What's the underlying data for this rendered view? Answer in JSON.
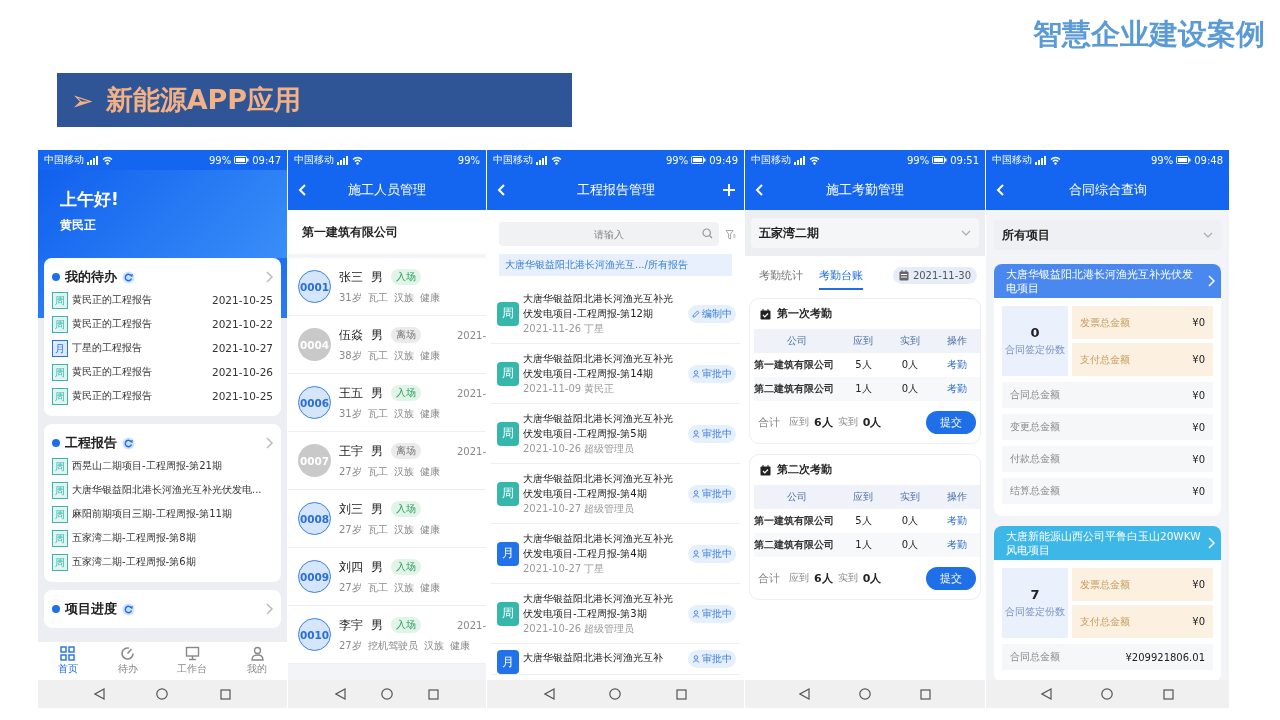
{
  "slide": {
    "brand": "智慧企业建设案例",
    "heading_marker": "➢",
    "heading": "新能源APP应用"
  },
  "phones": [
    {
      "kind": "home",
      "status": {
        "carrier": "中国移动",
        "battery": "99%",
        "time": "09:47"
      },
      "greeting": "上午好!",
      "user": "黄民正",
      "sections": [
        {
          "title": "我的待办",
          "items": [
            {
              "tag": "周",
              "color": "#35b8ab",
              "text": "黄民正的工程报告",
              "date": "2021-10-25"
            },
            {
              "tag": "周",
              "color": "#35b8ab",
              "text": "黄民正的工程报告",
              "date": "2021-10-22"
            },
            {
              "tag": "月",
              "color": "#2272ea",
              "text": "丁星的工程报告",
              "date": "2021-10-27"
            },
            {
              "tag": "周",
              "color": "#35b8ab",
              "text": "黄民正的工程报告",
              "date": "2021-10-26"
            },
            {
              "tag": "周",
              "color": "#35b8ab",
              "text": "黄民正的工程报告",
              "date": "2021-10-25"
            }
          ]
        },
        {
          "title": "工程报告",
          "items": [
            {
              "tag": "周",
              "color": "#35b8ab",
              "text": "西晃山二期项目-工程周报-第21期"
            },
            {
              "tag": "周",
              "color": "#35b8ab",
              "text": "大唐华银益阳北港长河渔光互补光伏发电..."
            },
            {
              "tag": "周",
              "color": "#35b8ab",
              "text": "麻阳前期项目三期-工程周报-第11期"
            },
            {
              "tag": "周",
              "color": "#35b8ab",
              "text": "五家湾二期-工程周报-第8期"
            },
            {
              "tag": "周",
              "color": "#35b8ab",
              "text": "五家湾二期-工程周报-第6期"
            }
          ]
        },
        {
          "title": "项目进度"
        }
      ],
      "tabbar": [
        {
          "label": "首页",
          "selected": true
        },
        {
          "label": "待办",
          "selected": false
        },
        {
          "label": "工作台",
          "selected": false
        },
        {
          "label": "我的",
          "selected": false
        }
      ]
    },
    {
      "kind": "staff",
      "status": {
        "carrier": "中国移动",
        "battery": "99%"
      },
      "title": "施工人员管理",
      "company": "第一建筑有限公司",
      "people": [
        {
          "id": "0001",
          "name": "张三",
          "gender": "男",
          "status": "入场",
          "present": true,
          "details": [
            "31岁",
            "瓦工",
            "汉族",
            "健康"
          ]
        },
        {
          "id": "0004",
          "name": "伍焱",
          "gender": "男",
          "status": "离场",
          "present": false,
          "details": [
            "38岁",
            "瓦工",
            "汉族",
            "健康"
          ],
          "date": "2021-"
        },
        {
          "id": "0006",
          "name": "王五",
          "gender": "男",
          "status": "入场",
          "present": true,
          "details": [
            "31岁",
            "瓦工",
            "汉族",
            "健康"
          ],
          "date": "2021-"
        },
        {
          "id": "0007",
          "name": "王宇",
          "gender": "男",
          "status": "离场",
          "present": false,
          "details": [
            "27岁",
            "瓦工",
            "汉族",
            "健康"
          ],
          "date": "2021-"
        },
        {
          "id": "0008",
          "name": "刘三",
          "gender": "男",
          "status": "入场",
          "present": true,
          "details": [
            "27岁",
            "瓦工",
            "汉族",
            "健康"
          ]
        },
        {
          "id": "0009",
          "name": "刘四",
          "gender": "男",
          "status": "入场",
          "present": true,
          "details": [
            "27岁",
            "瓦工",
            "汉族",
            "健康"
          ]
        },
        {
          "id": "0010",
          "name": "李宇",
          "gender": "男",
          "status": "入场",
          "present": true,
          "details": [
            "27岁",
            "挖机驾驶员",
            "汉族",
            "健康"
          ],
          "date": "2021-"
        }
      ]
    },
    {
      "kind": "reports",
      "status": {
        "carrier": "中国移动",
        "battery": "99%",
        "time": "09:49"
      },
      "title": "工程报告管理",
      "add_button": true,
      "search": {
        "placeholder": "请输入"
      },
      "breadcrumb": "大唐华银益阳北港长河渔光互.../所有报告",
      "reports": [
        {
          "tag": "周",
          "color": "#35b8ab",
          "title": "大唐华银益阳北港长河渔光互补光伏发电项目-工程周报-第12期",
          "meta": "2021-11-26 丁星",
          "status": "编制中",
          "kind": "draft"
        },
        {
          "tag": "周",
          "color": "#35b8ab",
          "title": "大唐华银益阳北港长河渔光互补光伏发电项目-工程周报-第14期",
          "meta": "2021-11-09 黄民正",
          "status": "审批中",
          "kind": "review"
        },
        {
          "tag": "周",
          "color": "#35b8ab",
          "title": "大唐华银益阳北港长河渔光互补光伏发电项目-工程周报-第5期",
          "meta": "2021-10-26 超级管理员",
          "status": "审批中",
          "kind": "review"
        },
        {
          "tag": "周",
          "color": "#35b8ab",
          "title": "大唐华银益阳北港长河渔光互补光伏发电项目-工程周报-第4期",
          "meta": "2021-10-27 超级管理员",
          "status": "审批中",
          "kind": "review"
        },
        {
          "tag": "月",
          "color": "#2272ea",
          "title": "大唐华银益阳北港长河渔光互补光伏发电项目-工程月报-第4期",
          "meta": "2021-10-27 丁星",
          "status": "审批中",
          "kind": "review"
        },
        {
          "tag": "周",
          "color": "#35b8ab",
          "title": "大唐华银益阳北港长河渔光互补光伏发电项目-工程周报-第3期",
          "meta": "2021-10-26 超级管理员",
          "status": "审批中",
          "kind": "review"
        },
        {
          "tag": "月",
          "color": "#2272ea",
          "title": "大唐华银益阳北港长河渔光互补",
          "status": "审批中",
          "kind": "review"
        }
      ]
    },
    {
      "kind": "attendance",
      "status": {
        "carrier": "中国移动",
        "battery": "99%",
        "time": "09:51"
      },
      "title": "施工考勤管理",
      "project": "五家湾二期",
      "tabs": [
        {
          "label": "考勤统计",
          "selected": false
        },
        {
          "label": "考勤台账",
          "selected": true
        }
      ],
      "date": "2021-11-30",
      "rounds": [
        {
          "title": "第一次考勤",
          "columns": [
            "公司",
            "应到",
            "实到",
            "操作"
          ],
          "rows": [
            {
              "company": "第一建筑有限公司",
              "expected": "5人",
              "actual": "0人",
              "action": "考勤"
            },
            {
              "company": "第二建筑有限公司",
              "expected": "1人",
              "actual": "0人",
              "action": "考勤"
            }
          ],
          "total_label": "合计",
          "expected_label": "应到",
          "expected_total": "6人",
          "actual_label": "实到",
          "actual_total": "0人",
          "button": "提交"
        },
        {
          "title": "第二次考勤",
          "columns": [
            "公司",
            "应到",
            "实到",
            "操作"
          ],
          "rows": [
            {
              "company": "第一建筑有限公司",
              "expected": "5人",
              "actual": "0人",
              "action": "考勤"
            },
            {
              "company": "第二建筑有限公司",
              "expected": "1人",
              "actual": "0人",
              "action": "考勤"
            }
          ],
          "total_label": "合计",
          "expected_label": "应到",
          "expected_total": "6人",
          "actual_label": "实到",
          "actual_total": "0人",
          "button": "提交"
        }
      ]
    },
    {
      "kind": "contracts",
      "status": {
        "carrier": "中国移动",
        "battery": "99%",
        "time": "09:48"
      },
      "title": "合同综合查询",
      "project": "所有项目",
      "projects": [
        {
          "name": "大唐华银益阳北港长河渔光互补光伏发电项目",
          "color": "#4a88ef",
          "count": "0",
          "count_label": "合同签定份数",
          "tiles": [
            {
              "label": "发票总金额",
              "value": "¥0"
            },
            {
              "label": "支付总金额",
              "value": "¥0"
            }
          ],
          "rows": [
            {
              "label": "合同总金额",
              "value": "¥0"
            },
            {
              "label": "变更总金额",
              "value": "¥0"
            },
            {
              "label": "付款总金额",
              "value": "¥0"
            },
            {
              "label": "结算总金额",
              "value": "¥0"
            }
          ]
        },
        {
          "name": "大唐新能源山西公司平鲁白玉山20WKW风电项目",
          "color": "#3db6e8",
          "count": "7",
          "count_label": "合同签定份数",
          "tiles": [
            {
              "label": "发票总金额",
              "value": "¥0"
            },
            {
              "label": "支付总金额",
              "value": "¥0"
            }
          ],
          "rows": [
            {
              "label": "合同总金额",
              "value": "¥209921806.01"
            }
          ]
        }
      ]
    }
  ]
}
